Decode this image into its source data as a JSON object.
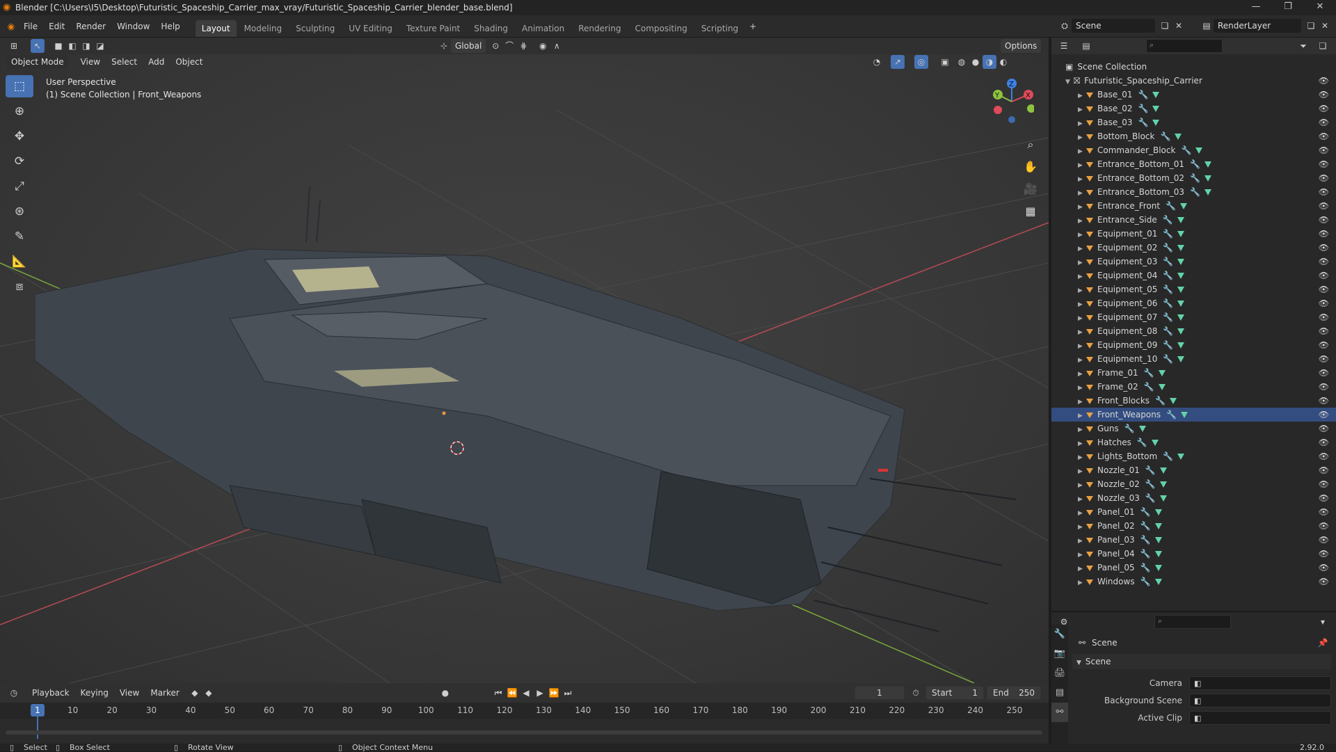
{
  "window": {
    "title": "Blender [C:\\Users\\I5\\Desktop\\Futuristic_Spaceship_Carrier_max_vray/Futuristic_Spaceship_Carrier_blender_base.blend]",
    "minimize": "—",
    "maximize": "❐",
    "close": "✕"
  },
  "menubar": [
    "File",
    "Edit",
    "Render",
    "Window",
    "Help"
  ],
  "workspaces": [
    {
      "label": "Layout",
      "active": true
    },
    {
      "label": "Modeling"
    },
    {
      "label": "Sculpting"
    },
    {
      "label": "UV Editing"
    },
    {
      "label": "Texture Paint"
    },
    {
      "label": "Shading"
    },
    {
      "label": "Animation"
    },
    {
      "label": "Rendering"
    },
    {
      "label": "Compositing"
    },
    {
      "label": "Scripting"
    }
  ],
  "add_workspace": "+",
  "scene": {
    "label": "Scene",
    "render_layer": "RenderLayer"
  },
  "viewport_header": {
    "mode": "Object Mode",
    "menus": [
      "View",
      "Select",
      "Add",
      "Object"
    ],
    "transform_orientation": "Global",
    "options": "Options"
  },
  "viewport": {
    "overlay_line1": "User Perspective",
    "overlay_line2": "(1) Scene Collection | Front_Weapons",
    "gizmo": {
      "z": "Z",
      "y": "Y",
      "x": "X"
    }
  },
  "outliner": {
    "root": "Scene Collection",
    "collection": "Futuristic_Spaceship_Carrier",
    "selected": "Front_Weapons",
    "objects": [
      "Base_01",
      "Base_02",
      "Base_03",
      "Bottom_Block",
      "Commander_Block",
      "Entrance_Bottom_01",
      "Entrance_Bottom_02",
      "Entrance_Bottom_03",
      "Entrance_Front",
      "Entrance_Side",
      "Equipment_01",
      "Equipment_02",
      "Equipment_03",
      "Equipment_04",
      "Equipment_05",
      "Equipment_06",
      "Equipment_07",
      "Equipment_08",
      "Equipment_09",
      "Equipment_10",
      "Frame_01",
      "Frame_02",
      "Front_Blocks",
      "Front_Weapons",
      "Guns",
      "Hatches",
      "Lights_Bottom",
      "Nozzle_01",
      "Nozzle_02",
      "Nozzle_03",
      "Panel_01",
      "Panel_02",
      "Panel_03",
      "Panel_04",
      "Panel_05",
      "Windows"
    ]
  },
  "properties": {
    "context": "Scene",
    "panel": "Scene",
    "fields": [
      {
        "label": "Camera",
        "value": ""
      },
      {
        "label": "Background Scene",
        "value": ""
      },
      {
        "label": "Active Clip",
        "value": ""
      }
    ]
  },
  "timeline": {
    "menus": [
      "Playback",
      "Keying",
      "View",
      "Marker"
    ],
    "current_frame": "1",
    "start_label": "Start",
    "start": "1",
    "end_label": "End",
    "end": "250",
    "ticks": [
      "10",
      "20",
      "30",
      "40",
      "50",
      "60",
      "70",
      "80",
      "90",
      "100",
      "110",
      "120",
      "130",
      "140",
      "150",
      "160",
      "170",
      "180",
      "190",
      "200",
      "210",
      "220",
      "230",
      "240",
      "250"
    ],
    "playhead_label": "1"
  },
  "statusbar": {
    "select": "Select",
    "box_select": "Box Select",
    "rotate_view": "Rotate View",
    "context_menu": "Object Context Menu",
    "version": "2.92.0"
  },
  "colors": {
    "accent": "#4772b3",
    "selection": "#334d80",
    "mesh_object": "#e8a042",
    "mesh_data": "#63d2a8",
    "modifier": "#6da4f0",
    "axis_x": "#e04a5a",
    "axis_y": "#8cc43e",
    "axis_z": "#3d82e8"
  }
}
